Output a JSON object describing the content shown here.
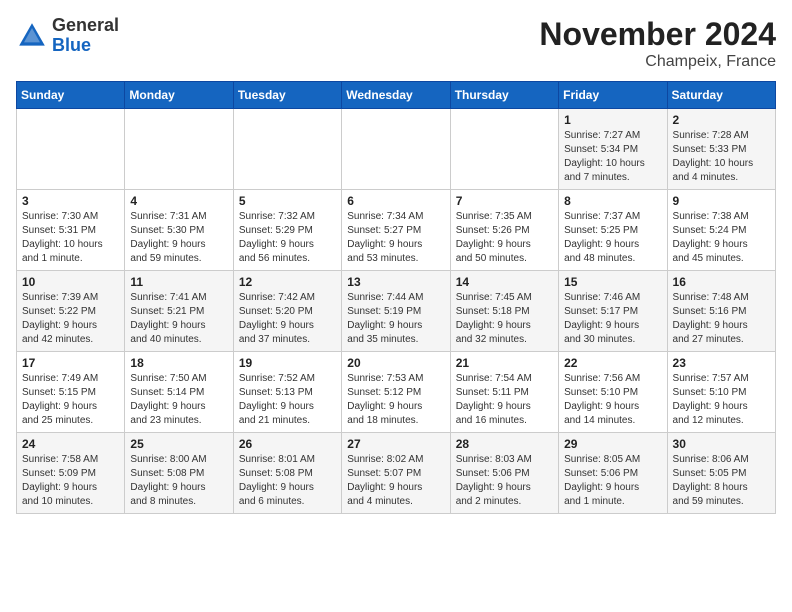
{
  "header": {
    "logo_general": "General",
    "logo_blue": "Blue",
    "month": "November 2024",
    "location": "Champeix, France"
  },
  "days_of_week": [
    "Sunday",
    "Monday",
    "Tuesday",
    "Wednesday",
    "Thursday",
    "Friday",
    "Saturday"
  ],
  "weeks": [
    [
      {
        "day": "",
        "info": ""
      },
      {
        "day": "",
        "info": ""
      },
      {
        "day": "",
        "info": ""
      },
      {
        "day": "",
        "info": ""
      },
      {
        "day": "",
        "info": ""
      },
      {
        "day": "1",
        "info": "Sunrise: 7:27 AM\nSunset: 5:34 PM\nDaylight: 10 hours\nand 7 minutes."
      },
      {
        "day": "2",
        "info": "Sunrise: 7:28 AM\nSunset: 5:33 PM\nDaylight: 10 hours\nand 4 minutes."
      }
    ],
    [
      {
        "day": "3",
        "info": "Sunrise: 7:30 AM\nSunset: 5:31 PM\nDaylight: 10 hours\nand 1 minute."
      },
      {
        "day": "4",
        "info": "Sunrise: 7:31 AM\nSunset: 5:30 PM\nDaylight: 9 hours\nand 59 minutes."
      },
      {
        "day": "5",
        "info": "Sunrise: 7:32 AM\nSunset: 5:29 PM\nDaylight: 9 hours\nand 56 minutes."
      },
      {
        "day": "6",
        "info": "Sunrise: 7:34 AM\nSunset: 5:27 PM\nDaylight: 9 hours\nand 53 minutes."
      },
      {
        "day": "7",
        "info": "Sunrise: 7:35 AM\nSunset: 5:26 PM\nDaylight: 9 hours\nand 50 minutes."
      },
      {
        "day": "8",
        "info": "Sunrise: 7:37 AM\nSunset: 5:25 PM\nDaylight: 9 hours\nand 48 minutes."
      },
      {
        "day": "9",
        "info": "Sunrise: 7:38 AM\nSunset: 5:24 PM\nDaylight: 9 hours\nand 45 minutes."
      }
    ],
    [
      {
        "day": "10",
        "info": "Sunrise: 7:39 AM\nSunset: 5:22 PM\nDaylight: 9 hours\nand 42 minutes."
      },
      {
        "day": "11",
        "info": "Sunrise: 7:41 AM\nSunset: 5:21 PM\nDaylight: 9 hours\nand 40 minutes."
      },
      {
        "day": "12",
        "info": "Sunrise: 7:42 AM\nSunset: 5:20 PM\nDaylight: 9 hours\nand 37 minutes."
      },
      {
        "day": "13",
        "info": "Sunrise: 7:44 AM\nSunset: 5:19 PM\nDaylight: 9 hours\nand 35 minutes."
      },
      {
        "day": "14",
        "info": "Sunrise: 7:45 AM\nSunset: 5:18 PM\nDaylight: 9 hours\nand 32 minutes."
      },
      {
        "day": "15",
        "info": "Sunrise: 7:46 AM\nSunset: 5:17 PM\nDaylight: 9 hours\nand 30 minutes."
      },
      {
        "day": "16",
        "info": "Sunrise: 7:48 AM\nSunset: 5:16 PM\nDaylight: 9 hours\nand 27 minutes."
      }
    ],
    [
      {
        "day": "17",
        "info": "Sunrise: 7:49 AM\nSunset: 5:15 PM\nDaylight: 9 hours\nand 25 minutes."
      },
      {
        "day": "18",
        "info": "Sunrise: 7:50 AM\nSunset: 5:14 PM\nDaylight: 9 hours\nand 23 minutes."
      },
      {
        "day": "19",
        "info": "Sunrise: 7:52 AM\nSunset: 5:13 PM\nDaylight: 9 hours\nand 21 minutes."
      },
      {
        "day": "20",
        "info": "Sunrise: 7:53 AM\nSunset: 5:12 PM\nDaylight: 9 hours\nand 18 minutes."
      },
      {
        "day": "21",
        "info": "Sunrise: 7:54 AM\nSunset: 5:11 PM\nDaylight: 9 hours\nand 16 minutes."
      },
      {
        "day": "22",
        "info": "Sunrise: 7:56 AM\nSunset: 5:10 PM\nDaylight: 9 hours\nand 14 minutes."
      },
      {
        "day": "23",
        "info": "Sunrise: 7:57 AM\nSunset: 5:10 PM\nDaylight: 9 hours\nand 12 minutes."
      }
    ],
    [
      {
        "day": "24",
        "info": "Sunrise: 7:58 AM\nSunset: 5:09 PM\nDaylight: 9 hours\nand 10 minutes."
      },
      {
        "day": "25",
        "info": "Sunrise: 8:00 AM\nSunset: 5:08 PM\nDaylight: 9 hours\nand 8 minutes."
      },
      {
        "day": "26",
        "info": "Sunrise: 8:01 AM\nSunset: 5:08 PM\nDaylight: 9 hours\nand 6 minutes."
      },
      {
        "day": "27",
        "info": "Sunrise: 8:02 AM\nSunset: 5:07 PM\nDaylight: 9 hours\nand 4 minutes."
      },
      {
        "day": "28",
        "info": "Sunrise: 8:03 AM\nSunset: 5:06 PM\nDaylight: 9 hours\nand 2 minutes."
      },
      {
        "day": "29",
        "info": "Sunrise: 8:05 AM\nSunset: 5:06 PM\nDaylight: 9 hours\nand 1 minute."
      },
      {
        "day": "30",
        "info": "Sunrise: 8:06 AM\nSunset: 5:05 PM\nDaylight: 8 hours\nand 59 minutes."
      }
    ]
  ]
}
